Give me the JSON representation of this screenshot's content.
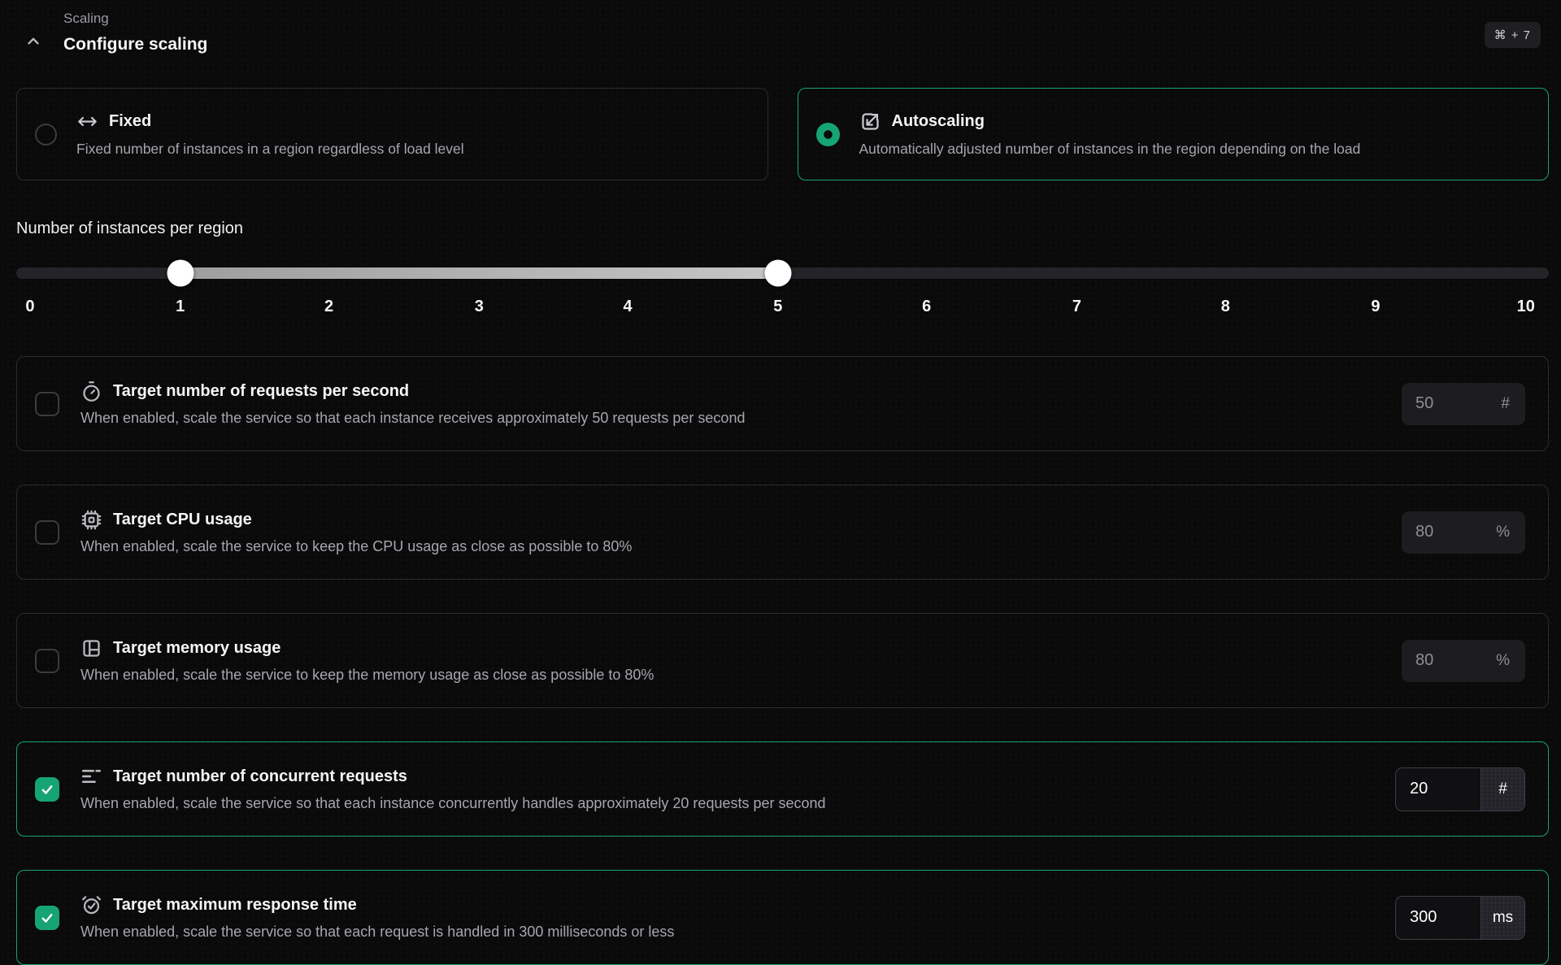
{
  "header": {
    "section_label": "Scaling",
    "title": "Configure scaling",
    "shortcut": "⌘ + 7"
  },
  "scaling_modes": [
    {
      "icon": "arrows-horizontal-icon",
      "label": "Fixed",
      "description": "Fixed number of instances in a region regardless of load level",
      "selected": false
    },
    {
      "icon": "autoscaling-expand-icon",
      "label": "Autoscaling",
      "description": "Automatically adjusted number of instances in the region depending on the load",
      "selected": true
    }
  ],
  "instances_slider": {
    "label": "Number of instances per region",
    "min": 0,
    "max": 10,
    "selected_min": 1,
    "selected_max": 5,
    "ticks": [
      "0",
      "1",
      "2",
      "3",
      "4",
      "5",
      "6",
      "7",
      "8",
      "9",
      "10"
    ]
  },
  "targets": [
    {
      "icon": "timer-icon",
      "title": "Target number of requests per second",
      "description": "When enabled, scale the service so that each instance receives approximately 50 requests per second",
      "value": "50",
      "unit": "#",
      "enabled": false
    },
    {
      "icon": "cpu-icon",
      "title": "Target CPU usage",
      "description": "When enabled, scale the service to keep the CPU usage as close as possible to 80%",
      "value": "80",
      "unit": "%",
      "enabled": false
    },
    {
      "icon": "memory-layout-icon",
      "title": "Target memory usage",
      "description": "When enabled, scale the service to keep the memory usage as close as possible to 80%",
      "value": "80",
      "unit": "%",
      "enabled": false
    },
    {
      "icon": "concurrent-lines-icon",
      "title": "Target number of concurrent requests",
      "description": "When enabled, scale the service so that each instance concurrently handles approximately 20 requests per second",
      "value": "20",
      "unit": "#",
      "enabled": true
    },
    {
      "icon": "alarm-clock-check-icon",
      "title": "Target maximum response time",
      "description": "When enabled, scale the service so that each request is handled in 300 milliseconds or less",
      "value": "300",
      "unit": "ms",
      "enabled": true
    }
  ],
  "colors": {
    "accent_green": "#17a473",
    "background": "#0a0a0b",
    "card_border": "#2c2c31"
  }
}
